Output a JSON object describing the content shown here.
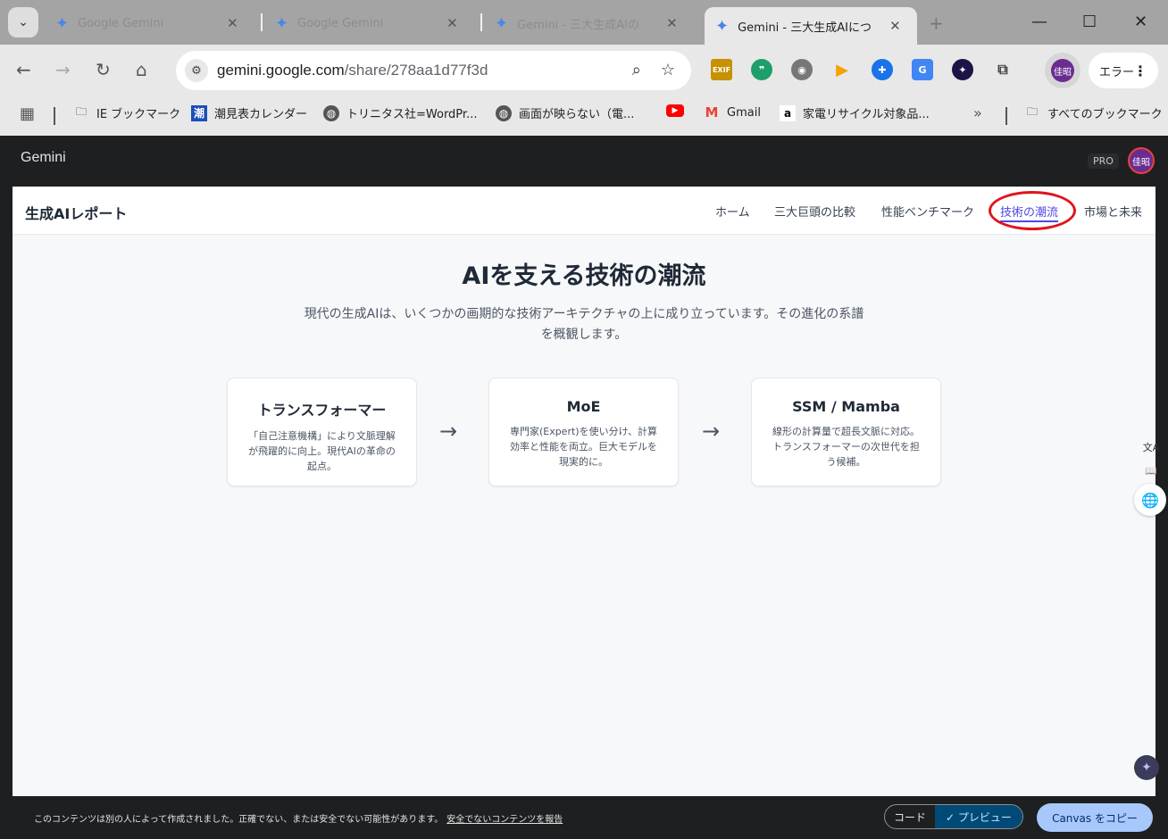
{
  "browser": {
    "tabs": [
      {
        "title": "Google Gemini",
        "active": false
      },
      {
        "title": "Google Gemini",
        "active": false
      },
      {
        "title": "Gemini - 三大生成AIの",
        "active": false
      },
      {
        "title": "Gemini - 三大生成AIにつ",
        "active": true
      }
    ],
    "url_host": "gemini.google.com",
    "url_path": "/share/278aa1d77f3d",
    "error_label": "エラー",
    "profile_initials": "佳昭"
  },
  "bookmarks": [
    {
      "label": "IE ブックマーク",
      "icon": "folder-icon"
    },
    {
      "label": "潮見表カレンダー",
      "icon": "tide-icon"
    },
    {
      "label": "トリニタス社=WordPr...",
      "icon": "globe-icon"
    },
    {
      "label": "画面が映らない（電...",
      "icon": "globe-icon"
    },
    {
      "label": "",
      "icon": "youtube-icon"
    },
    {
      "label": "Gmail",
      "icon": "gmail-icon"
    },
    {
      "label": "家電リサイクル対象品...",
      "icon": "amazon-icon"
    },
    {
      "label": "すべてのブックマーク",
      "icon": "folder-icon"
    }
  ],
  "gemini": {
    "logo": "Gemini",
    "pro_badge": "PRO",
    "avatar": "佳昭"
  },
  "site": {
    "brand": "生成AIレポート",
    "nav": [
      "ホーム",
      "三大巨頭の比較",
      "性能ベンチマーク",
      "技術の潮流",
      "市場と未来"
    ],
    "active_nav": "技術の潮流",
    "title": "AIを支える技術の潮流",
    "description": "現代の生成AIは、いくつかの画期的な技術アーキテクチャの上に成り立っています。その進化の系譜を概観します。",
    "cards": [
      {
        "title": "トランスフォーマー",
        "body": "「自己注意機構」により文脈理解が飛躍的に向上。現代AIの革命の起点。"
      },
      {
        "title": "MoE",
        "body": "専門家(Expert)を使い分け、計算効率と性能を両立。巨大モデルを現実的に。"
      },
      {
        "title": "SSM / Mamba",
        "body": "線形の計算量で超長文脈に対応。トランスフォーマーの次世代を担う候補。"
      }
    ],
    "arrow": "→"
  },
  "footer": {
    "notice": "このコンテンツは別の人によって作成されました。正確でない、または安全でない可能性があります。",
    "report_link": "安全でないコンテンツを報告",
    "code_label": "コード",
    "preview_label": "✓ プレビュー",
    "copy_label": "Canvas をコピー"
  },
  "colors": {
    "accent": "#4f46e5",
    "annotation_red": "#e1141c",
    "gemini_bg": "#1e1f20",
    "copy_button": "#a8c7fa"
  }
}
